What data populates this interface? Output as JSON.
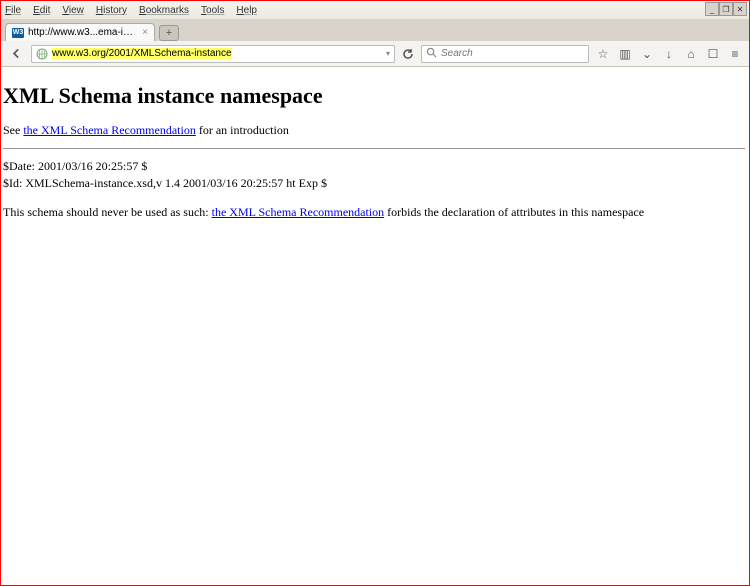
{
  "menu": {
    "items": [
      "File",
      "Edit",
      "View",
      "History",
      "Bookmarks",
      "Tools",
      "Help"
    ]
  },
  "tab": {
    "favicon_text": "W3",
    "title": "http://www.w3...ema-instance"
  },
  "url": {
    "prefix": "",
    "highlighted": "www.w3.org/2001/XMLSchema-instance"
  },
  "search": {
    "placeholder": "Search"
  },
  "page": {
    "heading": "XML Schema instance namespace",
    "intro_prefix": "See ",
    "intro_link": "the XML Schema Recommendation",
    "intro_suffix": " for an introduction",
    "date_line": "$Date: 2001/03/16 20:25:57 $",
    "id_line": "$Id: XMLSchema-instance.xsd,v 1.4 2001/03/16 20:25:57 ht Exp $",
    "footer_prefix": "This schema should never be used as such: ",
    "footer_link": "the XML Schema Recommendation",
    "footer_suffix": " forbids the declaration of attributes in this namespace"
  }
}
